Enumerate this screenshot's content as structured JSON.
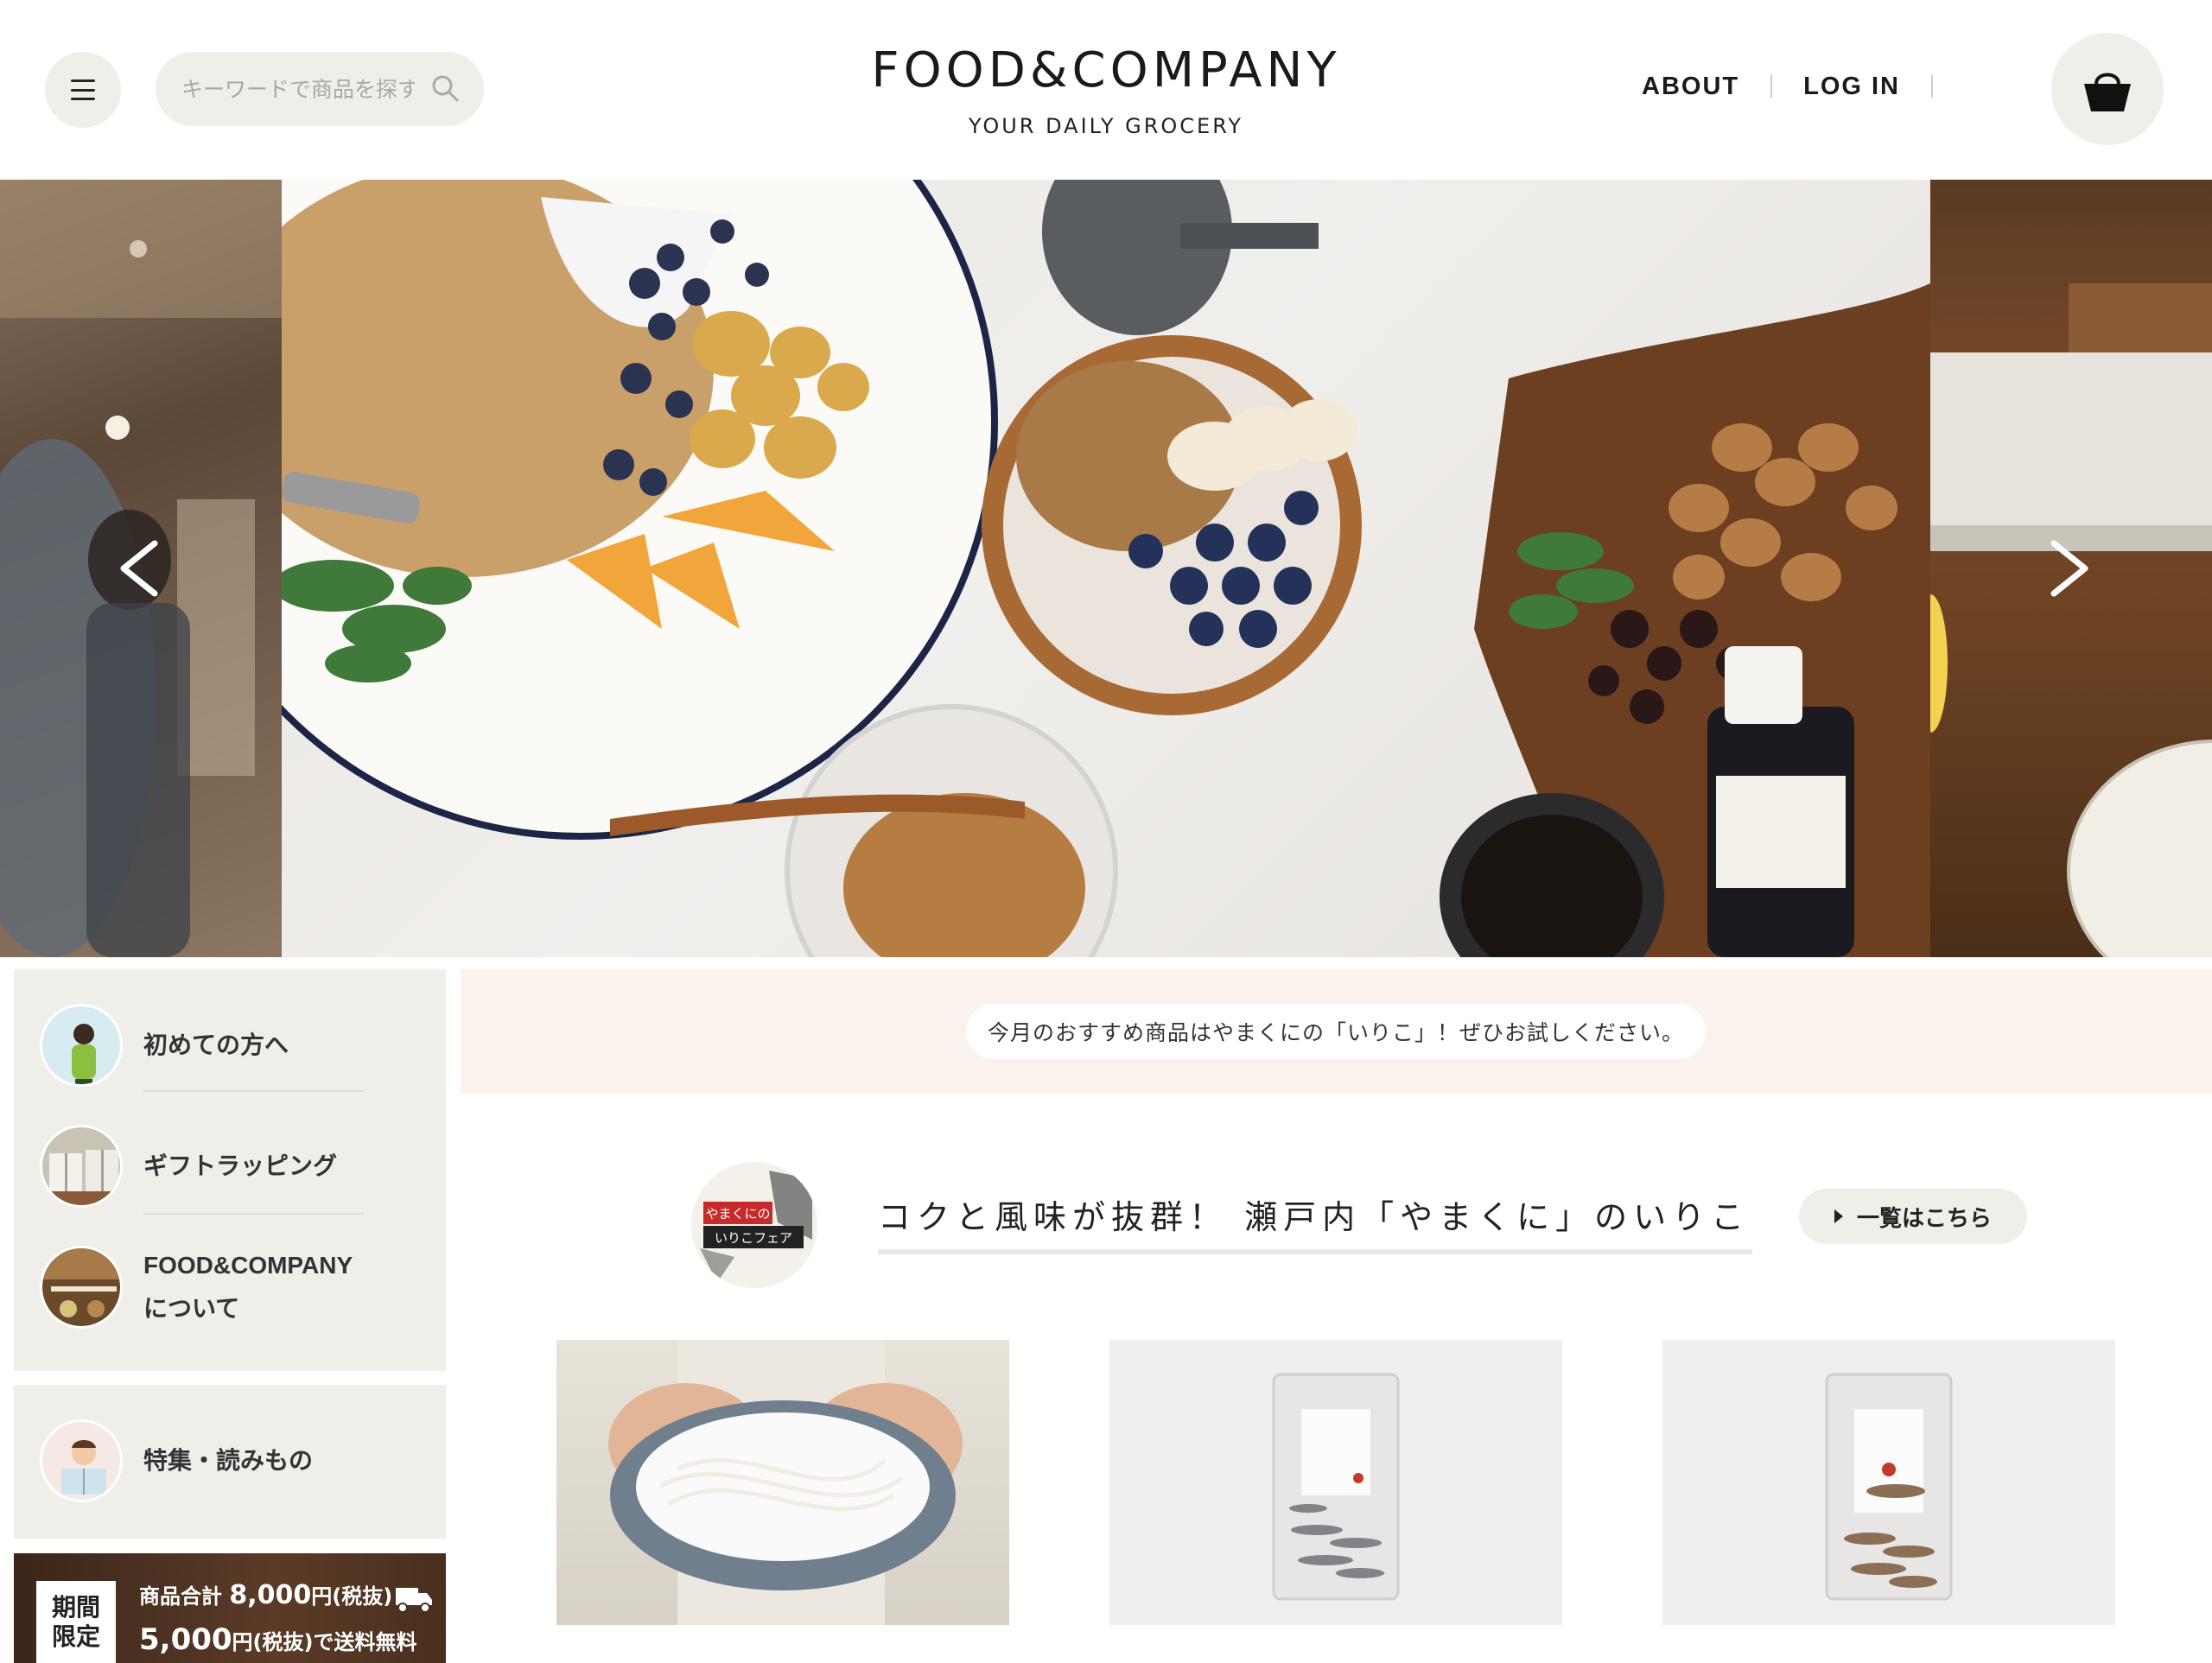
{
  "header": {
    "search_placeholder": "キーワードで商品を探す",
    "logo_main": "FOOD&COMPANY",
    "logo_sub": "YOUR DAILY GROCERY",
    "nav": [
      "ABOUT",
      "LOG IN"
    ]
  },
  "hero": {
    "prev_symbol": "<",
    "next_symbol": ">"
  },
  "sidebar": {
    "items": [
      {
        "label": "初めての方へ"
      },
      {
        "label": "ギフトラッピング"
      },
      {
        "label_line1": "FOOD&COMPANY",
        "label_line2": "について"
      },
      {
        "label": "特集・読みもの"
      }
    ],
    "promo": {
      "badge_line1": "期間",
      "badge_line2": "限定",
      "line1_prefix": "商品合計",
      "line1_amount": "8,000",
      "line1_suffix": "円(税抜)",
      "line2_amount": "5,000",
      "line2_suffix": "円(税抜)で送料無料"
    }
  },
  "notice": {
    "text": "今月のおすすめ商品はやまくにの「いりこ」！ぜひお試しください。"
  },
  "feature": {
    "title": "コクと風味が抜群！ 瀬戸内「やまくに」のいりこ",
    "button_label": "一覧はこちら",
    "badge_text_1": "やまくにの",
    "badge_text_2": "いりこフェア"
  },
  "colors": {
    "accent_gray": "#efeee9",
    "notice_bg": "#fbf2ec",
    "text": "#222222"
  }
}
